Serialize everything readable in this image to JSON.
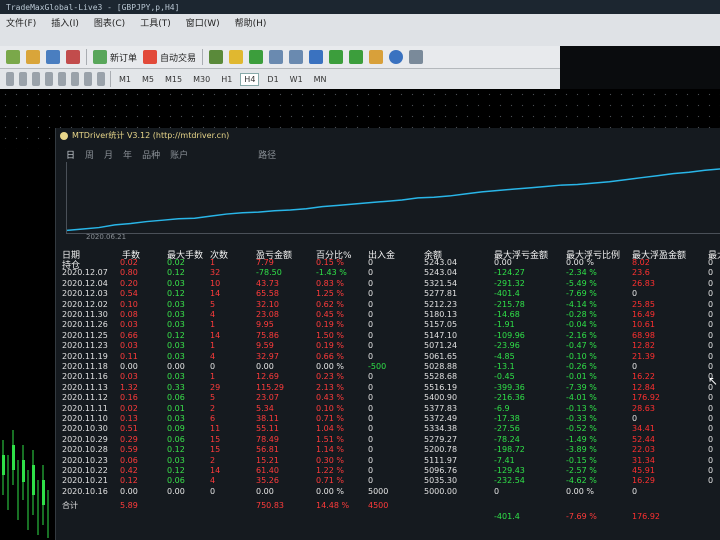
{
  "window": {
    "title": "TradeMaxGlobal-Live3 - [GBPJPY,p,H4]"
  },
  "menu": [
    "文件(F)",
    "插入(I)",
    "图表(C)",
    "工具(T)",
    "窗口(W)",
    "帮助(H)"
  ],
  "toolbar": {
    "new_order": "新订单",
    "auto_trading": "自动交易"
  },
  "timeframes": [
    "M1",
    "M5",
    "M15",
    "M30",
    "H1",
    "H4",
    "D1",
    "W1",
    "MN"
  ],
  "timeframe_selected": "H4",
  "panel": {
    "title": "MTDriver统计 V3.12 (http://mtdriver.cn)",
    "tabs": [
      "日",
      "周",
      "月",
      "年",
      "品种",
      "账户"
    ],
    "extra_tab": "路径",
    "equity_start_label": "2020.06.21"
  },
  "table": {
    "headers": {
      "date": "日期",
      "date_sub": "持仓",
      "lots": "手数",
      "max_lots": "最大手数",
      "count": "次数",
      "pl": "盈亏金额",
      "pct": "百分比%",
      "io": "出入金",
      "balance": "余额",
      "max_float_loss": "最大浮亏金额",
      "max_float_loss_ratio": "最大浮亏比例",
      "max_float_gain": "最大浮盈金额",
      "last": "最大"
    },
    "rows": [
      {
        "date": "",
        "lots": "0.02",
        "max_lots": "0.02",
        "count": "1",
        "pl": "7.79",
        "pct": "0.15 %",
        "io": "0",
        "bal": "5243.04",
        "fl": "0.00",
        "flr": "0.00 %",
        "mfg": "8.02",
        "last": "0"
      },
      {
        "date": "2020.12.07",
        "lots": "0.80",
        "max_lots": "0.12",
        "count": "32",
        "pl": "-78.50",
        "pct": "-1.43 %",
        "io": "0",
        "bal": "5243.04",
        "fl": "-124.27",
        "flr": "-2.34 %",
        "mfg": "23.6",
        "last": "0"
      },
      {
        "date": "2020.12.04",
        "lots": "0.20",
        "max_lots": "0.03",
        "count": "10",
        "pl": "43.73",
        "pct": "0.83 %",
        "io": "0",
        "bal": "5321.54",
        "fl": "-291.32",
        "flr": "-5.49 %",
        "mfg": "26.83",
        "last": "0"
      },
      {
        "date": "2020.12.03",
        "lots": "0.54",
        "max_lots": "0.12",
        "count": "14",
        "pl": "65.58",
        "pct": "1.25 %",
        "io": "0",
        "bal": "5277.81",
        "fl": "-401.4",
        "flr": "-7.69 %",
        "mfg": "0",
        "last": "0"
      },
      {
        "date": "2020.12.02",
        "lots": "0.10",
        "max_lots": "0.03",
        "count": "5",
        "pl": "32.10",
        "pct": "0.62 %",
        "io": "0",
        "bal": "5212.23",
        "fl": "-215.78",
        "flr": "-4.14 %",
        "mfg": "25.85",
        "last": "0"
      },
      {
        "date": "2020.11.30",
        "lots": "0.08",
        "max_lots": "0.03",
        "count": "4",
        "pl": "23.08",
        "pct": "0.45 %",
        "io": "0",
        "bal": "5180.13",
        "fl": "-14.68",
        "flr": "-0.28 %",
        "mfg": "16.49",
        "last": "0"
      },
      {
        "date": "2020.11.26",
        "lots": "0.03",
        "max_lots": "0.03",
        "count": "1",
        "pl": "9.95",
        "pct": "0.19 %",
        "io": "0",
        "bal": "5157.05",
        "fl": "-1.91",
        "flr": "-0.04 %",
        "mfg": "10.61",
        "last": "0"
      },
      {
        "date": "2020.11.25",
        "lots": "0.66",
        "max_lots": "0.12",
        "count": "14",
        "pl": "75.86",
        "pct": "1.50 %",
        "io": "0",
        "bal": "5147.10",
        "fl": "-109.96",
        "flr": "-2.16 %",
        "mfg": "68.98",
        "last": "0"
      },
      {
        "date": "2020.11.23",
        "lots": "0.03",
        "max_lots": "0.03",
        "count": "1",
        "pl": "9.59",
        "pct": "0.19 %",
        "io": "0",
        "bal": "5071.24",
        "fl": "-23.96",
        "flr": "-0.47 %",
        "mfg": "12.82",
        "last": "0"
      },
      {
        "date": "2020.11.19",
        "lots": "0.11",
        "max_lots": "0.03",
        "count": "4",
        "pl": "32.97",
        "pct": "0.66 %",
        "io": "0",
        "bal": "5061.65",
        "fl": "-4.85",
        "flr": "-0.10 %",
        "mfg": "21.39",
        "last": "0"
      },
      {
        "date": "2020.11.18",
        "lots": "0.00",
        "max_lots": "0.00",
        "count": "0",
        "pl": "0.00",
        "pct": "0.00 %",
        "io": "-500",
        "bal": "5028.88",
        "fl": "-13.1",
        "flr": "-0.26 %",
        "mfg": "0",
        "last": "0"
      },
      {
        "date": "2020.11.16",
        "lots": "0.03",
        "max_lots": "0.03",
        "count": "1",
        "pl": "12.69",
        "pct": "0.23 %",
        "io": "0",
        "bal": "5528.68",
        "fl": "-0.45",
        "flr": "-0.01 %",
        "mfg": "16.22",
        "last": "0"
      },
      {
        "date": "2020.11.13",
        "lots": "1.32",
        "max_lots": "0.33",
        "count": "29",
        "pl": "115.29",
        "pct": "2.13 %",
        "io": "0",
        "bal": "5516.19",
        "fl": "-399.36",
        "flr": "-7.39 %",
        "mfg": "12.84",
        "last": "0"
      },
      {
        "date": "2020.11.12",
        "lots": "0.16",
        "max_lots": "0.06",
        "count": "5",
        "pl": "23.07",
        "pct": "0.43 %",
        "io": "0",
        "bal": "5400.90",
        "fl": "-216.36",
        "flr": "-4.01 %",
        "mfg": "176.92",
        "last": "0"
      },
      {
        "date": "2020.11.11",
        "lots": "0.02",
        "max_lots": "0.01",
        "count": "2",
        "pl": "5.34",
        "pct": "0.10 %",
        "io": "0",
        "bal": "5377.83",
        "fl": "-6.9",
        "flr": "-0.13 %",
        "mfg": "28.63",
        "last": "0"
      },
      {
        "date": "2020.11.10",
        "lots": "0.13",
        "max_lots": "0.03",
        "count": "6",
        "pl": "38.11",
        "pct": "0.71 %",
        "io": "0",
        "bal": "5372.49",
        "fl": "-17.38",
        "flr": "-0.33 %",
        "mfg": "0",
        "last": "0"
      },
      {
        "date": "2020.10.30",
        "lots": "0.51",
        "max_lots": "0.09",
        "count": "11",
        "pl": "55.11",
        "pct": "1.04 %",
        "io": "0",
        "bal": "5334.38",
        "fl": "-27.56",
        "flr": "-0.52 %",
        "mfg": "34.41",
        "last": "0"
      },
      {
        "date": "2020.10.29",
        "lots": "0.29",
        "max_lots": "0.06",
        "count": "15",
        "pl": "78.49",
        "pct": "1.51 %",
        "io": "0",
        "bal": "5279.27",
        "fl": "-78.24",
        "flr": "-1.49 %",
        "mfg": "52.44",
        "last": "0"
      },
      {
        "date": "2020.10.28",
        "lots": "0.59",
        "max_lots": "0.12",
        "count": "15",
        "pl": "56.81",
        "pct": "1.14 %",
        "io": "0",
        "bal": "5200.78",
        "fl": "-198.72",
        "flr": "-3.89 %",
        "mfg": "22.03",
        "last": "0"
      },
      {
        "date": "2020.10.23",
        "lots": "0.06",
        "max_lots": "0.03",
        "count": "2",
        "pl": "15.21",
        "pct": "0.30 %",
        "io": "0",
        "bal": "5111.97",
        "fl": "-7.41",
        "flr": "-0.15 %",
        "mfg": "31.34",
        "last": "0"
      },
      {
        "date": "2020.10.22",
        "lots": "0.42",
        "max_lots": "0.12",
        "count": "14",
        "pl": "61.40",
        "pct": "1.22 %",
        "io": "0",
        "bal": "5096.76",
        "fl": "-129.43",
        "flr": "-2.57 %",
        "mfg": "45.91",
        "last": "0"
      },
      {
        "date": "2020.10.21",
        "lots": "0.12",
        "max_lots": "0.06",
        "count": "4",
        "pl": "35.26",
        "pct": "0.71 %",
        "io": "0",
        "bal": "5035.30",
        "fl": "-232.54",
        "flr": "-4.62 %",
        "mfg": "16.29",
        "last": "0"
      },
      {
        "date": "2020.10.16",
        "lots": "0.00",
        "max_lots": "0.00",
        "count": "0",
        "pl": "0.00",
        "pct": "0.00 %",
        "io": "5000",
        "bal": "5000.00",
        "fl": "0",
        "flr": "0.00 %",
        "mfg": "0",
        "last": ""
      }
    ],
    "total": {
      "label": "合计",
      "lots": "5.89",
      "pl": "750.83",
      "pct": "14.48 %",
      "io": "4500",
      "fl": "-401.4",
      "flr": "-7.69 %",
      "mfg": "176.92"
    }
  },
  "equity_curve": [
    0.04,
    0.06,
    0.08,
    0.12,
    0.14,
    0.17,
    0.19,
    0.21,
    0.22,
    0.25,
    0.28,
    0.3,
    0.31,
    0.33,
    0.34,
    0.36,
    0.39,
    0.41,
    0.43,
    0.45,
    0.47,
    0.49,
    0.52,
    0.53,
    0.55,
    0.58,
    0.61,
    0.63,
    0.65,
    0.67,
    0.69,
    0.71,
    0.72,
    0.74,
    0.76,
    0.79,
    0.82,
    0.85,
    0.88,
    0.9,
    0.93,
    0.95
  ],
  "colors": {
    "equity_line": "#29b6e8",
    "positive": "#2fe048",
    "negative": "#ff3b3b",
    "panel_bg": "#151a1f"
  }
}
